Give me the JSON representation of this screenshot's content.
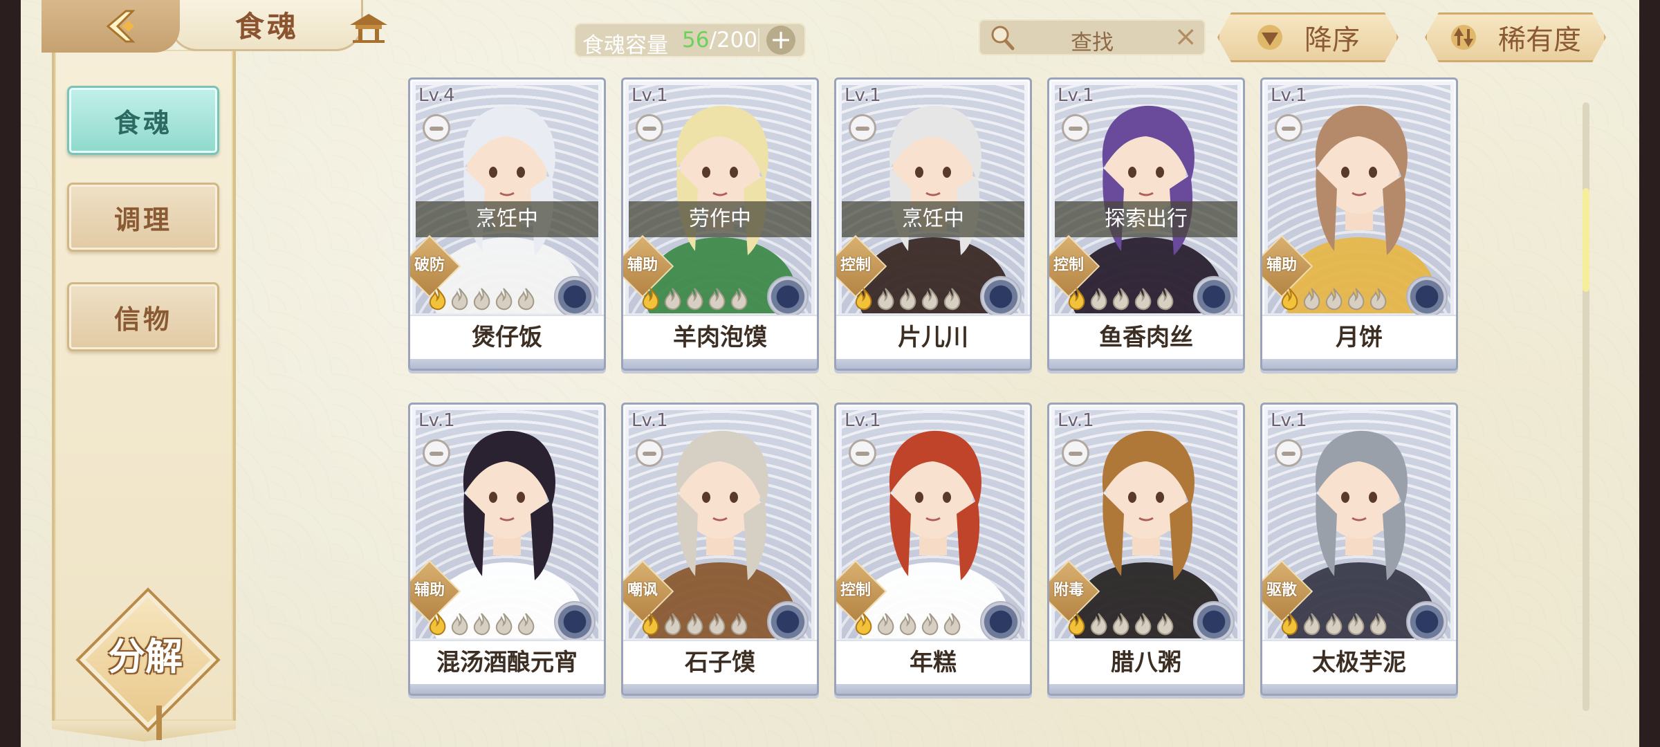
{
  "header": {
    "title": "食魂",
    "capacity_label": "食魂容量",
    "capacity_current": "56",
    "capacity_max": "/200",
    "capacity_add": "+",
    "search_placeholder": "查找",
    "search_clear": "×",
    "sort_order_label": "降序",
    "sort_rarity_label": "稀有度"
  },
  "sidebar": {
    "items": [
      {
        "label": "食魂",
        "active": true
      },
      {
        "label": "调理",
        "active": false
      },
      {
        "label": "信物",
        "active": false
      }
    ],
    "decompose_label": "分解"
  },
  "colors": {
    "accent_teal": "#8fd9cc",
    "capacity_green": "#6cd25b",
    "card_border": "#9aa3ba",
    "gold": "#d9b070"
  },
  "cards": [
    {
      "level": "Lv.4",
      "name": "煲仔饭",
      "status": "烹饪中",
      "role": "破防",
      "stars_lit": 1,
      "stars_total": 5,
      "hair": "#e9ecf2",
      "outfit": "#f4f4f4"
    },
    {
      "level": "Lv.1",
      "name": "羊肉泡馍",
      "status": "劳作中",
      "role": "辅助",
      "stars_lit": 1,
      "stars_total": 5,
      "hair": "#efe2a8",
      "outfit": "#3f8a4a"
    },
    {
      "level": "Lv.1",
      "name": "片儿川",
      "status": "烹饪中",
      "role": "控制",
      "stars_lit": 1,
      "stars_total": 5,
      "hair": "#e6e6e6",
      "outfit": "#3b2a26"
    },
    {
      "level": "Lv.1",
      "name": "鱼香肉丝",
      "status": "探索出行",
      "role": "控制",
      "stars_lit": 1,
      "stars_total": 5,
      "hair": "#6a4a9a",
      "outfit": "#2a2030"
    },
    {
      "level": "Lv.1",
      "name": "月饼",
      "status": "",
      "role": "辅助",
      "stars_lit": 1,
      "stars_total": 5,
      "hair": "#b58a6a",
      "outfit": "#e6b64a"
    },
    {
      "level": "Lv.1",
      "name": "混汤酒酿元宵",
      "status": "",
      "role": "辅助",
      "stars_lit": 1,
      "stars_total": 5,
      "hair": "#2a2230",
      "outfit": "#ffffff"
    },
    {
      "level": "Lv.1",
      "name": "石子馍",
      "status": "",
      "role": "嘲讽",
      "stars_lit": 1,
      "stars_total": 5,
      "hair": "#d6d0c4",
      "outfit": "#8a5a32"
    },
    {
      "level": "Lv.1",
      "name": "年糕",
      "status": "",
      "role": "控制",
      "stars_lit": 1,
      "stars_total": 5,
      "hair": "#c0442a",
      "outfit": "#ffffff"
    },
    {
      "level": "Lv.1",
      "name": "腊八粥",
      "status": "",
      "role": "附毒",
      "stars_lit": 1,
      "stars_total": 5,
      "hair": "#b07838",
      "outfit": "#2a2626"
    },
    {
      "level": "Lv.1",
      "name": "太极芋泥",
      "status": "",
      "role": "驱散",
      "stars_lit": 1,
      "stars_total": 5,
      "hair": "#9aa0aa",
      "outfit": "#3a3a4a"
    }
  ],
  "scrollbar": {
    "position": 0.17
  }
}
